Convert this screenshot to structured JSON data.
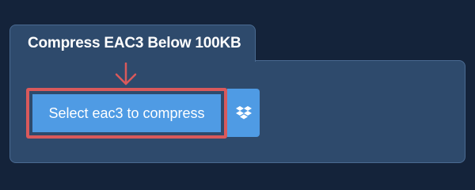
{
  "card": {
    "title": "Compress EAC3 Below 100KB"
  },
  "upload": {
    "button_label": "Select eac3 to compress"
  },
  "icons": {
    "arrow": "arrow-down-icon",
    "dropbox": "dropbox-icon"
  },
  "colors": {
    "page_background": "#14233a",
    "card_background": "#2e4a6c",
    "button_blue": "#4f9be4",
    "highlight_red": "#d9595b"
  }
}
